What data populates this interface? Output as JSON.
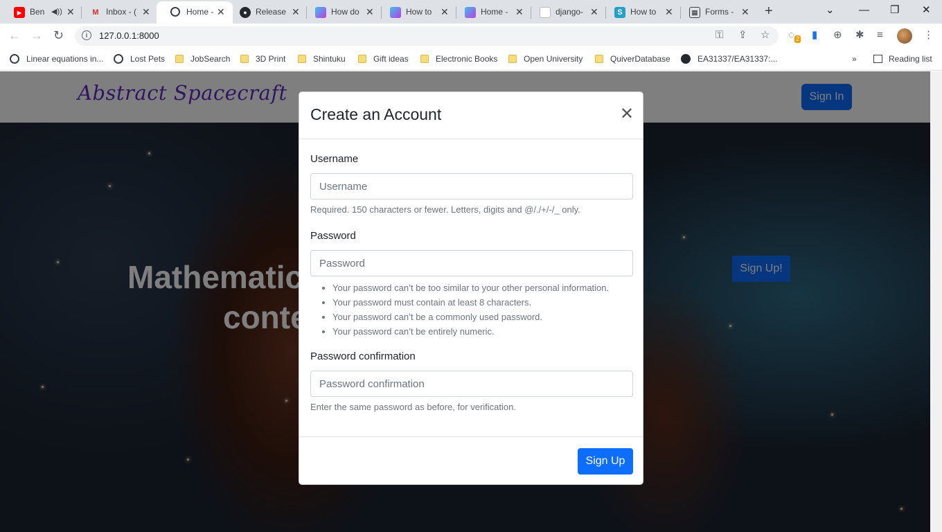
{
  "browser": {
    "tabs": [
      {
        "label": "Ben",
        "favicon": "youtube-icon"
      },
      {
        "label": "Inbox - (",
        "favicon": "gmail-icon"
      },
      {
        "label": "Home -",
        "favicon": "globe-icon"
      },
      {
        "label": "Release",
        "favicon": "github-icon"
      },
      {
        "label": "How do",
        "favicon": "page-icon"
      },
      {
        "label": "How to",
        "favicon": "page-icon"
      },
      {
        "label": "Home -",
        "favicon": "page-icon"
      },
      {
        "label": "django-",
        "favicon": "page-icon"
      },
      {
        "label": "How to",
        "favicon": "stackoverflow-icon"
      },
      {
        "label": "Forms -",
        "favicon": "docs-icon"
      }
    ],
    "active_tab": 2,
    "url": "127.0.0.1:8000",
    "extension_badge": "2",
    "bookmarks": [
      {
        "label": "Linear equations in...",
        "type": "globe"
      },
      {
        "label": "Lost Pets",
        "type": "globe"
      },
      {
        "label": "JobSearch",
        "type": "folder"
      },
      {
        "label": "3D Print",
        "type": "folder"
      },
      {
        "label": "Shintuku",
        "type": "folder"
      },
      {
        "label": "Gift ideas",
        "type": "folder"
      },
      {
        "label": "Electronic Books",
        "type": "folder"
      },
      {
        "label": "Open University",
        "type": "folder"
      },
      {
        "label": "QuiverDatabase",
        "type": "folder"
      },
      {
        "label": "EA31337/EA31337:...",
        "type": "github"
      }
    ],
    "bookmarks_overflow": "»",
    "reading_list": "Reading list"
  },
  "site": {
    "brand": "Abstract Spacecraft",
    "signin_label": "Sign In",
    "hero_title_line1": "Mathematic",
    "hero_title_line2": "conte",
    "hero_button": "Sign Up!"
  },
  "modal": {
    "title": "Create an Account",
    "username_label": "Username",
    "username_placeholder": "Username",
    "username_help": "Required. 150 characters or fewer. Letters, digits and @/./+/-/_ only.",
    "password_label": "Password",
    "password_placeholder": "Password",
    "password_rules": [
      "Your password can’t be too similar to your other personal information.",
      "Your password must contain at least 8 characters.",
      "Your password can’t be a commonly used password.",
      "Your password can’t be entirely numeric."
    ],
    "confirm_label": "Password confirmation",
    "confirm_placeholder": "Password confirmation",
    "confirm_help": "Enter the same password as before, for verification.",
    "submit_label": "Sign Up"
  },
  "colors": {
    "primary": "#0d6efd",
    "brand": "#5f2cc4"
  }
}
